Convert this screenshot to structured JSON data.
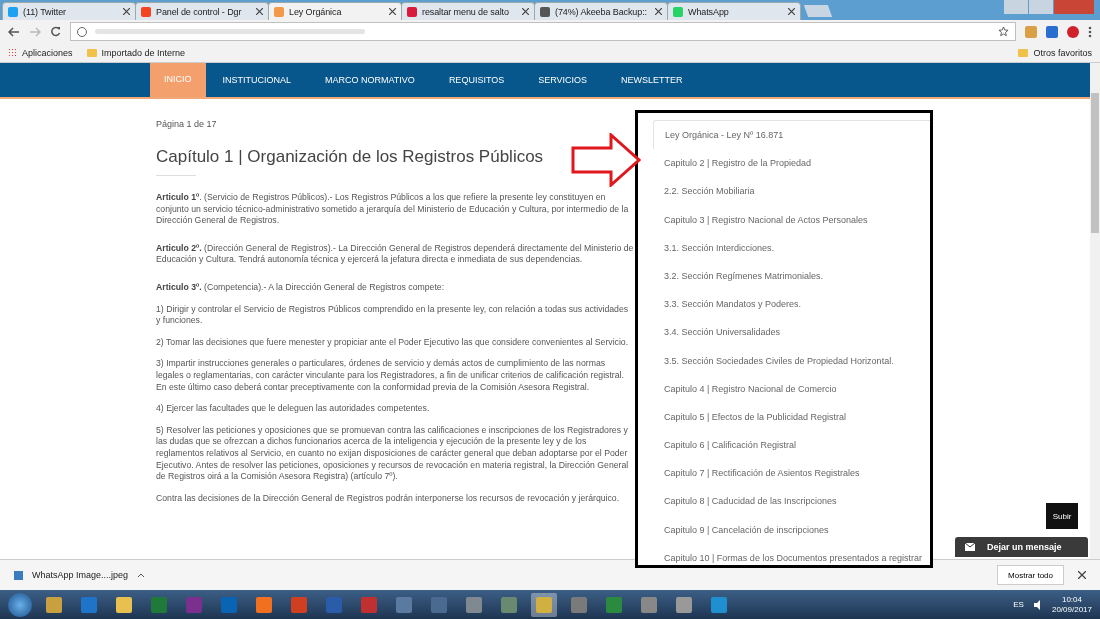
{
  "browser": {
    "tabs": [
      {
        "title": "(11) Twitter",
        "selected": false
      },
      {
        "title": "Panel de control - Dgr",
        "selected": false
      },
      {
        "title": "Ley Orgánica",
        "selected": true
      },
      {
        "title": "resaltar menu de salto",
        "selected": false
      },
      {
        "title": "(74%) Akeeba Backup::",
        "selected": false
      },
      {
        "title": "WhatsApp",
        "selected": false
      }
    ],
    "bookmarks": [
      {
        "label": "Aplicaciones"
      },
      {
        "label": "Importado de Interne"
      }
    ],
    "other_bookmarks": "Otros favoritos"
  },
  "nav": [
    {
      "label": "INICIO",
      "selected": true
    },
    {
      "label": "INSTITUCIONAL",
      "selected": false
    },
    {
      "label": "MARCO NORMATIVO",
      "selected": false
    },
    {
      "label": "REQUISITOS",
      "selected": false
    },
    {
      "label": "SERVICIOS",
      "selected": false
    },
    {
      "label": "NEWSLETTER",
      "selected": false
    }
  ],
  "page_indicator": "Página 1 de 17",
  "heading": "Capítulo 1 | Organización de los Registros Públicos",
  "paragraphs": [
    "**Articulo 1º**. (Servicio de Registros Públicos).- Los Registros Públicos a los que refiere la presente ley constituyen en conjunto un servicio técnico-administrativo sometido a jerarquía del Ministerio de Educación y Cultura, por intermedio de la Dirección General de Registros.",
    "**Articulo 2º.** (Dirección General de Registros).- La Dirección General de Registros dependerá directamente del Ministerio de Educación y Cultura. Tendrá autonomía técnica y ejercerá la jefatura directa e inmediata de sus dependencias.",
    "**Articulo 3º.** (Competencia).- A la Dirección General de Registros compete:",
    "1) Dirigir y controlar el Servicio de Registros Públicos comprendido en la presente ley, con relación a todas sus actividades y funciones.",
    "2) Tomar las decisiones que fuere menester y propiciar ante el Poder Ejecutivo las que considere convenientes al Servicio.",
    "3) Impartir instrucciones generales o particulares, órdenes de servicio y demás actos de cumplimiento de las normas legales o reglamentarias, con carácter vinculante para los Registradores, a fin de unificar criterios de calificación registral. En este último caso deberá contar preceptivamente con la conformidad previa de la Comisión Asesora Registral.",
    "4) Ejercer las facultades que le deleguen las autoridades competentes.",
    "5) Resolver las peticiones y oposiciones que se promuevan contra las calificaciones e inscripciones de los Registradores y las dudas que se ofrezcan a dichos funcionarios acerca de la inteligencia y ejecución de la presente ley y de los reglamentos relativos al Servicio, en cuanto no exijan disposiciones de carácter general que deban adoptarse por el Poder Ejecutivo. Antes de resolver las peticiones, oposiciones y recursos de revocación en materia registral, la Dirección General de Registros oirá a la Comisión Asesora Registra) (artículo 7º).",
    "Contra las decisiones de la Dirección General de Registros podrán interponerse los recursos de revocación y jerárquico."
  ],
  "toc": [
    {
      "label": "Ley Orgánica - Ley Nº 16.871",
      "selected": true
    },
    {
      "label": "Capitulo 2 | Registro de la Propiedad",
      "selected": false
    },
    {
      "label": "2.2. Sección Mobiliaria",
      "selected": false
    },
    {
      "label": "Capitulo 3 | Registro Nacional de Actos Personales",
      "selected": false
    },
    {
      "label": "3.1. Sección Interdicciones.",
      "selected": false
    },
    {
      "label": "3.2. Sección Regímenes Matrimoniales.",
      "selected": false
    },
    {
      "label": "3.3. Sección Mandatos y Poderes.",
      "selected": false
    },
    {
      "label": "3.4. Sección Universalidades",
      "selected": false
    },
    {
      "label": "3.5. Sección Sociedades Civiles de Propiedad Horizontal.",
      "selected": false
    },
    {
      "label": "Capitulo 4 | Registro Nacional de Comercio",
      "selected": false
    },
    {
      "label": "Capitulo 5 | Efectos de la Publicidad Registral",
      "selected": false
    },
    {
      "label": "Capitulo 6 | Calificación Registral",
      "selected": false
    },
    {
      "label": "Capitulo 7 | Rectificación de Asientos Registrales",
      "selected": false
    },
    {
      "label": "Capitulo 8 | Caducidad de las Inscripciones",
      "selected": false
    },
    {
      "label": "Capitulo 9 | Cancelación de inscripciones",
      "selected": false
    },
    {
      "label": "Capitulo 10 | Formas de los Documentos presentados a registrar",
      "selected": false
    }
  ],
  "scroll_top_button": "Subir",
  "chat_button": "Dejar un mensaje",
  "download": {
    "file": "WhatsApp Image....jpeg",
    "show_all": "Mostrar todo"
  },
  "taskbar": {
    "language": "ES",
    "time": "10:04",
    "date": "20/09/2017"
  }
}
